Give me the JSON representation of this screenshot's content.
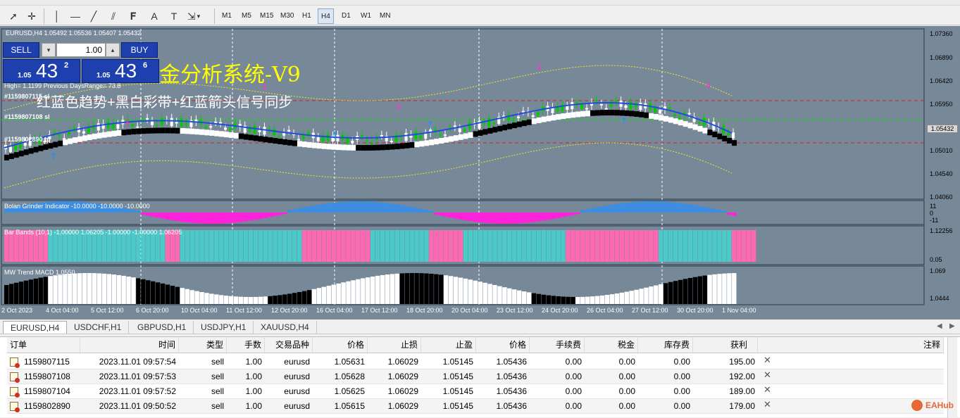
{
  "toolbar": {
    "timeframes": [
      "M1",
      "M5",
      "M15",
      "M30",
      "H1",
      "H4",
      "D1",
      "W1",
      "MN"
    ],
    "active_timeframe": "H4",
    "text_tool_label": "A"
  },
  "chart": {
    "symbol_header": "EURUSD,H4  1.05492 1.05536 1.05407 1.05432",
    "one_click": {
      "sell_label": "SELL",
      "buy_label": "BUY",
      "lot_value": "1.00",
      "sell_price_prefix": "1.05",
      "sell_price_big": "43",
      "sell_price_sup": "2",
      "buy_price_prefix": "1.05",
      "buy_price_big": "43",
      "buy_price_sup": "6"
    },
    "overlay_title": "金分析系统-V9",
    "overlay_subtitle": "红蓝色趋势+黑白彩带+红蓝箭头信号同步",
    "hilo_text": "High= 1.1199 Previous DaysRange= 73.8",
    "order_labels": [
      "#1159807115 sl",
      "#1159807108 sl",
      "#1159802890 tp"
    ],
    "current_price_tag": "1.05432",
    "price_axis": [
      "1.07360",
      "1.06890",
      "1.06420",
      "1.05950",
      "1.05010",
      "1.04540",
      "1.04060"
    ],
    "indicator_panes": [
      {
        "title": "Bolan Grinder Indicator -10.0000 -10.0000 -10.0000",
        "axis": [
          "11",
          "0",
          "-11"
        ]
      },
      {
        "title": "Bar Bands (10,1) -1.00000 1.06205 -1.00000 -1.00000 1.06205",
        "axis": [
          "1.12256",
          "0.05"
        ]
      },
      {
        "title": "MW Trend MACD 1.0550",
        "axis": [
          "1.069",
          "1.0444"
        ]
      }
    ],
    "time_axis": [
      "2 Oct 2023",
      "4 Oct 04:00",
      "5 Oct 12:00",
      "6 Oct 20:00",
      "10 Oct 04:00",
      "11 Oct 12:00",
      "12 Oct 20:00",
      "16 Oct 04:00",
      "17 Oct 12:00",
      "18 Oct 20:00",
      "20 Oct 04:00",
      "23 Oct 12:00",
      "24 Oct 20:00",
      "26 Oct 04:00",
      "27 Oct 12:00",
      "30 Oct 20:00",
      "1 Nov 04:00"
    ]
  },
  "symbol_tabs": [
    "EURUSD,H4",
    "USDCHF,H1",
    "GBPUSD,H1",
    "USDJPY,H1",
    "XAUUSD,H4"
  ],
  "active_symbol_tab": "EURUSD,H4",
  "trade_table": {
    "columns": [
      "订单",
      "时间",
      "类型",
      "手数",
      "交易品种",
      "价格",
      "止损",
      "止盈",
      "价格",
      "手续费",
      "税金",
      "库存费",
      "获利",
      "注释"
    ],
    "rows": [
      [
        "1159807115",
        "2023.11.01 09:57:54",
        "sell",
        "1.00",
        "eurusd",
        "1.05631",
        "1.06029",
        "1.05145",
        "1.05436",
        "0.00",
        "0.00",
        "0.00",
        "195.00"
      ],
      [
        "1159807108",
        "2023.11.01 09:57:53",
        "sell",
        "1.00",
        "eurusd",
        "1.05628",
        "1.06029",
        "1.05145",
        "1.05436",
        "0.00",
        "0.00",
        "0.00",
        "192.00"
      ],
      [
        "1159807104",
        "2023.11.01 09:57:52",
        "sell",
        "1.00",
        "eurusd",
        "1.05625",
        "1.06029",
        "1.05145",
        "1.05436",
        "0.00",
        "0.00",
        "0.00",
        "189.00"
      ],
      [
        "1159802890",
        "2023.11.01 09:50:52",
        "sell",
        "1.00",
        "eurusd",
        "1.05615",
        "1.06029",
        "1.05145",
        "1.05436",
        "0.00",
        "0.00",
        "0.00",
        "179.00"
      ]
    ]
  },
  "watermark": "EAHub"
}
